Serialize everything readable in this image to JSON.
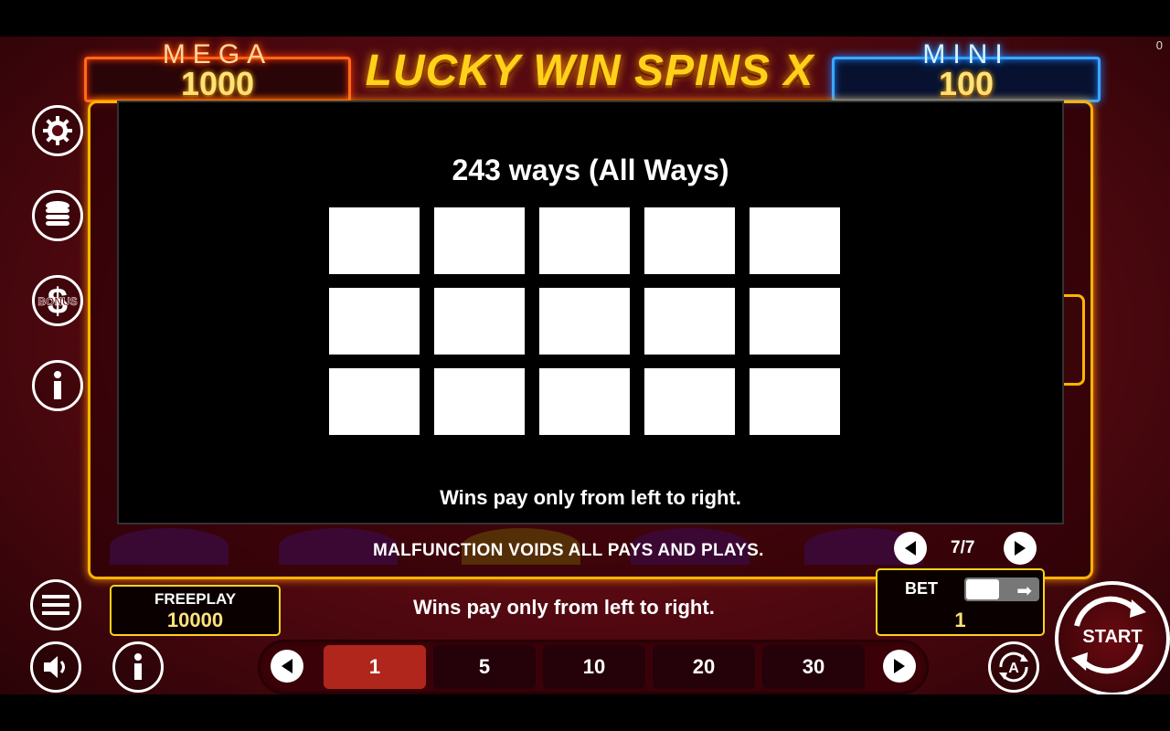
{
  "corner_counter": "0",
  "jackpots": {
    "mega": {
      "label": "MEGA",
      "value": "1000"
    },
    "mini": {
      "label": "MINI",
      "value": "100"
    }
  },
  "logo_text": "LUCKY WIN SPINS X",
  "side_buttons": [
    {
      "name": "settings",
      "icon": "gear-icon"
    },
    {
      "name": "coins",
      "icon": "coin-stack-icon"
    },
    {
      "name": "bonus",
      "icon": "dollar-icon",
      "label": "BONUS"
    },
    {
      "name": "info",
      "icon": "info-icon"
    }
  ],
  "info_panel": {
    "title": "243 ways (All Ways)",
    "grid": {
      "rows": 3,
      "cols": 5
    },
    "note": "Wins pay only from left to right."
  },
  "malfunction_text": "MALFUNCTION VOIDS ALL PAYS AND PLAYS.",
  "pager": {
    "current": "7/7"
  },
  "freeplay": {
    "label": "FREEPLAY",
    "value": "10000"
  },
  "bottom_message": "Wins pay only from left to right.",
  "bet": {
    "label": "BET",
    "value": "1"
  },
  "bet_options": [
    "1",
    "5",
    "10",
    "20",
    "30"
  ],
  "selected_bet": "1",
  "start_label": "START",
  "colors": {
    "gold": "#ffd21a",
    "mega_frame": "#ff6a1a",
    "mini_frame": "#3aa8ff",
    "active_chip": "#b0261c"
  }
}
